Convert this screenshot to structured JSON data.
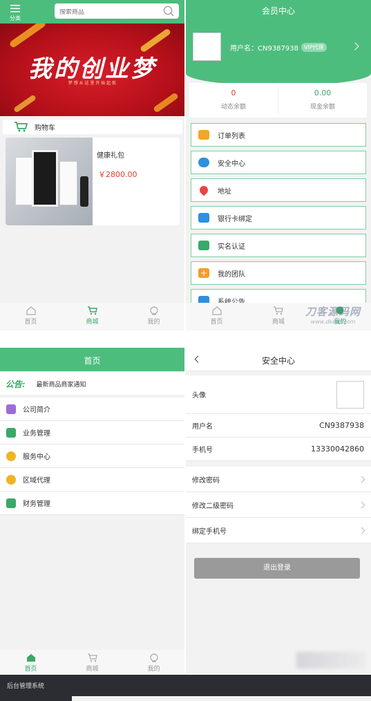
{
  "colors": {
    "green": "#4dbd7d",
    "price": "#e23b2a",
    "banner": "#c1121b"
  },
  "shop": {
    "category_label": "分类",
    "search_placeholder": "搜索商品",
    "banner_title": "我的创业梦",
    "banner_sub": "梦 想 从 这 里 开 始 起 航",
    "cart_label": "购物车",
    "product": {
      "name": "健康礼包",
      "price": "￥2800.00"
    },
    "tabs": [
      {
        "label": "首页"
      },
      {
        "label": "商城"
      },
      {
        "label": "我的"
      }
    ]
  },
  "member": {
    "title": "会员中心",
    "username_text": "用户名：CN9387938",
    "vip_badge": "VIP代理",
    "balances": [
      {
        "value": "0",
        "label": "动态余额"
      },
      {
        "value": "0.00",
        "label": "现金余额"
      }
    ],
    "menu": [
      {
        "label": "订单列表",
        "color": "#f5a623"
      },
      {
        "label": "安全中心",
        "color": "#2f8fe0"
      },
      {
        "label": "地址",
        "color": "#e94343"
      },
      {
        "label": "银行卡绑定",
        "color": "#2f8fe0"
      },
      {
        "label": "实名认证",
        "color": "#3aa86a"
      },
      {
        "label": "我的团队",
        "color": "#f39c2b"
      },
      {
        "label": "系统公告",
        "color": "#2f8fe0"
      }
    ],
    "tabs": [
      {
        "label": "首页"
      },
      {
        "label": "商城"
      },
      {
        "label": "我的"
      }
    ],
    "watermark_main": "刀客源码网",
    "watermark_url": "www.dkewl.com"
  },
  "home": {
    "title": "首页",
    "notice_label": "公告:",
    "notice_text": "最新商品商家通知",
    "items": [
      {
        "label": "公司简介",
        "color": "#9b6cd9"
      },
      {
        "label": "业务管理",
        "color": "#3aa86a"
      },
      {
        "label": "服务中心",
        "color": "#f0b323"
      },
      {
        "label": "区域代理",
        "color": "#f0b323"
      },
      {
        "label": "财务管理",
        "color": "#3aa86a"
      }
    ],
    "tabs": [
      {
        "label": "首页"
      },
      {
        "label": "商城"
      },
      {
        "label": "我的"
      }
    ]
  },
  "security": {
    "title": "安全中心",
    "avatar_label": "头像",
    "username_label": "用户名",
    "username_value": "CN9387938",
    "phone_label": "手机号",
    "phone_value": "13330042860",
    "links": [
      "修改密码",
      "修改二级密码",
      "绑定手机号"
    ],
    "logout_label": "退出登录"
  },
  "footer": {
    "admin_label": "后台管理系统"
  }
}
